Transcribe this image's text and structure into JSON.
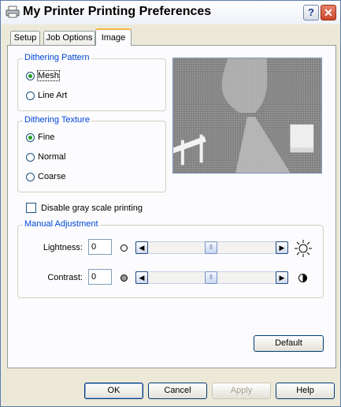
{
  "window": {
    "title": "My Printer Printing Preferences",
    "help": "?",
    "close": "✕"
  },
  "tabs": [
    {
      "label": "Setup"
    },
    {
      "label": "Job Options"
    },
    {
      "label": "Image"
    }
  ],
  "dithering_pattern": {
    "legend": "Dithering Pattern",
    "options": [
      {
        "label": "Mesh",
        "checked": true
      },
      {
        "label": "Line Art",
        "checked": false
      }
    ]
  },
  "dithering_texture": {
    "legend": "Dithering Texture",
    "options": [
      {
        "label": "Fine",
        "checked": true
      },
      {
        "label": "Normal",
        "checked": false
      },
      {
        "label": "Coarse",
        "checked": false
      }
    ]
  },
  "disable_gray": {
    "label": "Disable gray scale printing",
    "checked": false
  },
  "manual_adjustment": {
    "legend": "Manual Adjustment",
    "lightness": {
      "label": "Lightness:",
      "value": "0"
    },
    "contrast": {
      "label": "Contrast:",
      "value": "0"
    }
  },
  "buttons": {
    "default": "Default",
    "ok": "OK",
    "cancel": "Cancel",
    "apply": "Apply",
    "help": "Help"
  }
}
